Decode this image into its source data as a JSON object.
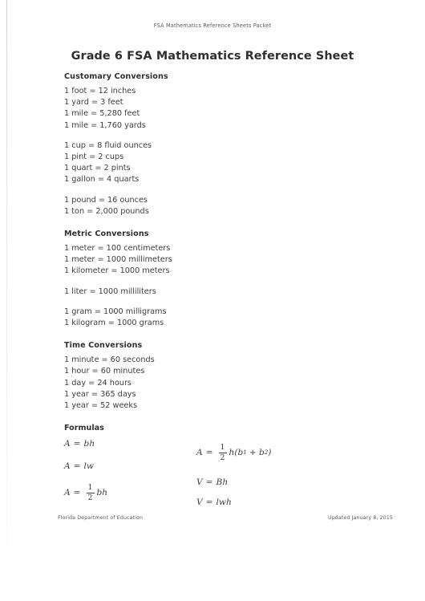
{
  "running_head": "FSA Mathematics Reference Sheets Packet",
  "title": "Grade 6 FSA Mathematics Reference Sheet",
  "sections": [
    {
      "heading": "Customary Conversions",
      "groups": [
        [
          "1 foot = 12 inches",
          "1 yard = 3 feet",
          "1 mile = 5,280 feet",
          "1 mile = 1,760 yards"
        ],
        [
          "1 cup = 8 fluid ounces",
          "1 pint = 2 cups",
          "1 quart = 2 pints",
          "1 gallon = 4 quarts"
        ],
        [
          "1 pound = 16 ounces",
          "1 ton = 2,000 pounds"
        ]
      ]
    },
    {
      "heading": "Metric Conversions",
      "groups": [
        [
          "1 meter = 100 centimeters",
          "1 meter = 1000 millimeters",
          "1 kilometer = 1000 meters"
        ],
        [
          "1 liter = 1000 milliliters"
        ],
        [
          "1 gram = 1000 milligrams",
          "1 kilogram = 1000 grams"
        ]
      ]
    },
    {
      "heading": "Time Conversions",
      "groups": [
        [
          "1 minute = 60 seconds",
          "1 hour = 60 minutes",
          "1 day = 24 hours",
          "1 year = 365 days",
          "1 year = 52 weeks"
        ]
      ]
    }
  ],
  "formulas": {
    "heading": "Formulas",
    "left": {
      "f1": {
        "lhs": "A",
        "eq": "=",
        "rhs": "bh"
      },
      "f2": {
        "lhs": "A",
        "eq": "=",
        "rhs": "lw"
      },
      "f3": {
        "lhs": "A",
        "eq": "=",
        "num": "1",
        "den": "2",
        "rhs": "bh"
      }
    },
    "right": {
      "f1": {
        "lhs": "A",
        "eq": "=",
        "num": "1",
        "den": "2",
        "rhs_pre": "h(b",
        "sub1": "1",
        "plus": "+ b",
        "sub2": "2",
        "rhs_post": ")"
      },
      "f2": {
        "lhs": "V",
        "eq": "=",
        "rhs": "Bh"
      },
      "f3": {
        "lhs": "V",
        "eq": "=",
        "rhs": "lwh"
      }
    }
  },
  "footer": {
    "left": "Florida Department of Education",
    "right": "Updated January 8, 2015"
  }
}
